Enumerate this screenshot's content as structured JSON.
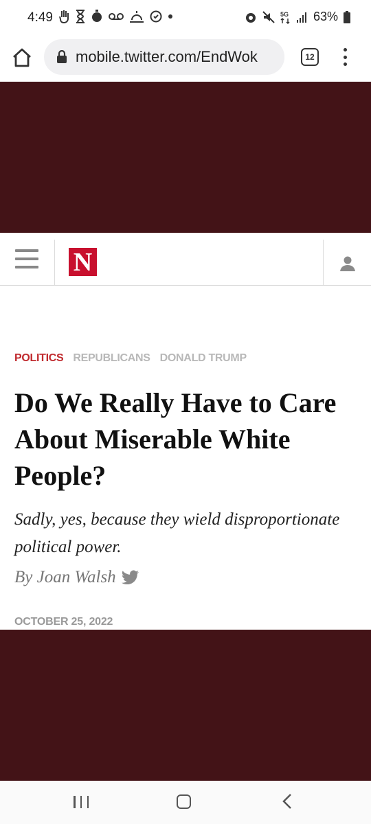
{
  "status_bar": {
    "time": "4:49",
    "battery_percent": "63%",
    "network": "5G",
    "left_icons": [
      "hand-icon",
      "hourglass-icon",
      "timer-icon",
      "voicemail-icon",
      "weather-icon",
      "clock-icon",
      "dot-icon"
    ],
    "right_icons": [
      "alarm-icon",
      "mute-icon",
      "5g-icon",
      "signal-icon",
      "battery-icon"
    ]
  },
  "browser": {
    "url": "mobile.twitter.com/EndWok",
    "tab_count": "12",
    "icons": [
      "home-icon",
      "lock-icon",
      "more-vert-icon"
    ]
  },
  "site_header": {
    "logo_text": "N",
    "logo_color": "#c8102e",
    "icons": [
      "hamburger-menu-icon",
      "account-icon"
    ]
  },
  "article": {
    "tags": [
      {
        "label": "POLITICS",
        "color": "#c02a2e"
      },
      {
        "label": "REPUBLICANS",
        "color": "#b8b8b8"
      },
      {
        "label": "DONALD TRUMP",
        "color": "#b8b8b8"
      }
    ],
    "headline": "Do We Really Have to Care About Miserable White People?",
    "subhead": "Sadly, yes, because they wield disproportionate political power.",
    "byline": "By Joan Walsh",
    "date": "OCTOBER 25, 2022"
  },
  "ad_color": "#431317",
  "nav_bar": {
    "icons": [
      "recent-apps-icon",
      "home-button-icon",
      "back-icon"
    ]
  }
}
